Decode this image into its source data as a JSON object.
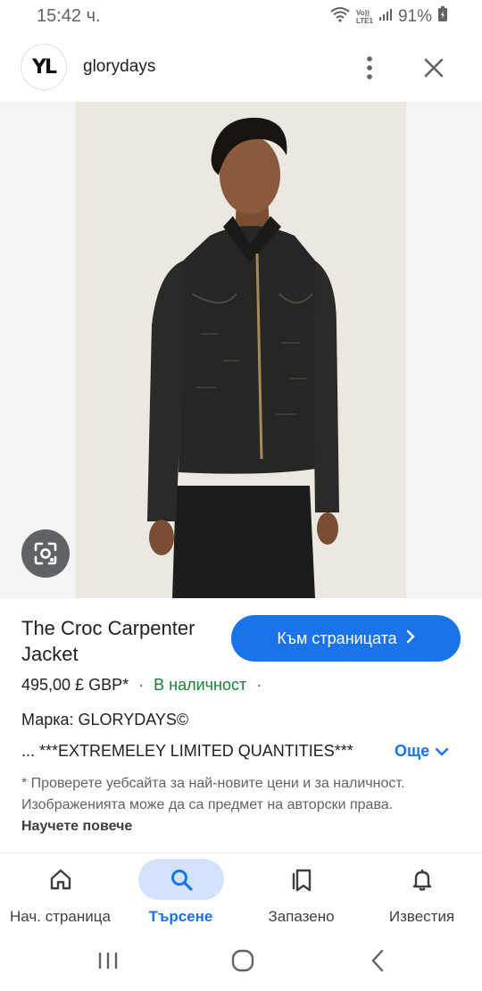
{
  "status_bar": {
    "time": "15:42 ч.",
    "network_top": "Vo))",
    "network_bottom": "LTE1",
    "battery": "91%",
    "icons": [
      "wifi-icon",
      "signal-icon",
      "battery-icon"
    ]
  },
  "header": {
    "logo_text": "YL",
    "site_name": "glorydays",
    "icons": [
      "more-vert-icon",
      "close-icon"
    ]
  },
  "product": {
    "title": "The Croc Carpenter Jacket",
    "visit_label": "Към страницата",
    "price": "495,00 £ GBP*",
    "availability": "В наличност",
    "brand": "Марка: GLORYDAYS©",
    "description": "... ***EXTREMELEY LIMITED QUANTITIES***",
    "more_label": "Още",
    "disclaimer": "* Проверете уебсайта за най-новите цени и за наличност. Изображенията може да са предмет на авторски права.",
    "learn_more": "Научете повече"
  },
  "bottom_nav": [
    {
      "label": "Нач. страница",
      "icon": "home-icon",
      "active": false
    },
    {
      "label": "Търсене",
      "icon": "search-icon",
      "active": true
    },
    {
      "label": "Запазено",
      "icon": "bookmarks-icon",
      "active": false
    },
    {
      "label": "Известия",
      "icon": "bell-icon",
      "active": false
    }
  ],
  "colors": {
    "accent": "#1a73e8",
    "in_stock": "#188038",
    "active_pill": "#d3e3fd"
  }
}
